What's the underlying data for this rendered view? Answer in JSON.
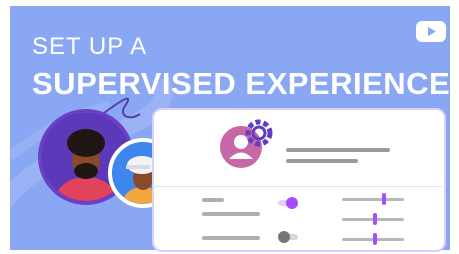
{
  "video": {
    "title_line1": "SET UP A",
    "title_line2": "SUPERVISED EXPERIENCE"
  },
  "icons": {
    "logo": "youtube-play-icon",
    "settings": "gear-icon",
    "profile": "person-icon"
  },
  "settings_panel": {
    "toggles": [
      {
        "state": "on",
        "color": "#a64dff"
      },
      {
        "state": "off",
        "color": "#777777"
      }
    ],
    "sliders": [
      {
        "level": 0.6
      },
      {
        "level": 0.45
      },
      {
        "level": 0.45
      }
    ]
  },
  "colors": {
    "background": "#8aa7f3",
    "accent_purple": "#a64dff",
    "avatar_magenta": "#c867a6",
    "youtube_red_play": "#8aa7f3"
  }
}
